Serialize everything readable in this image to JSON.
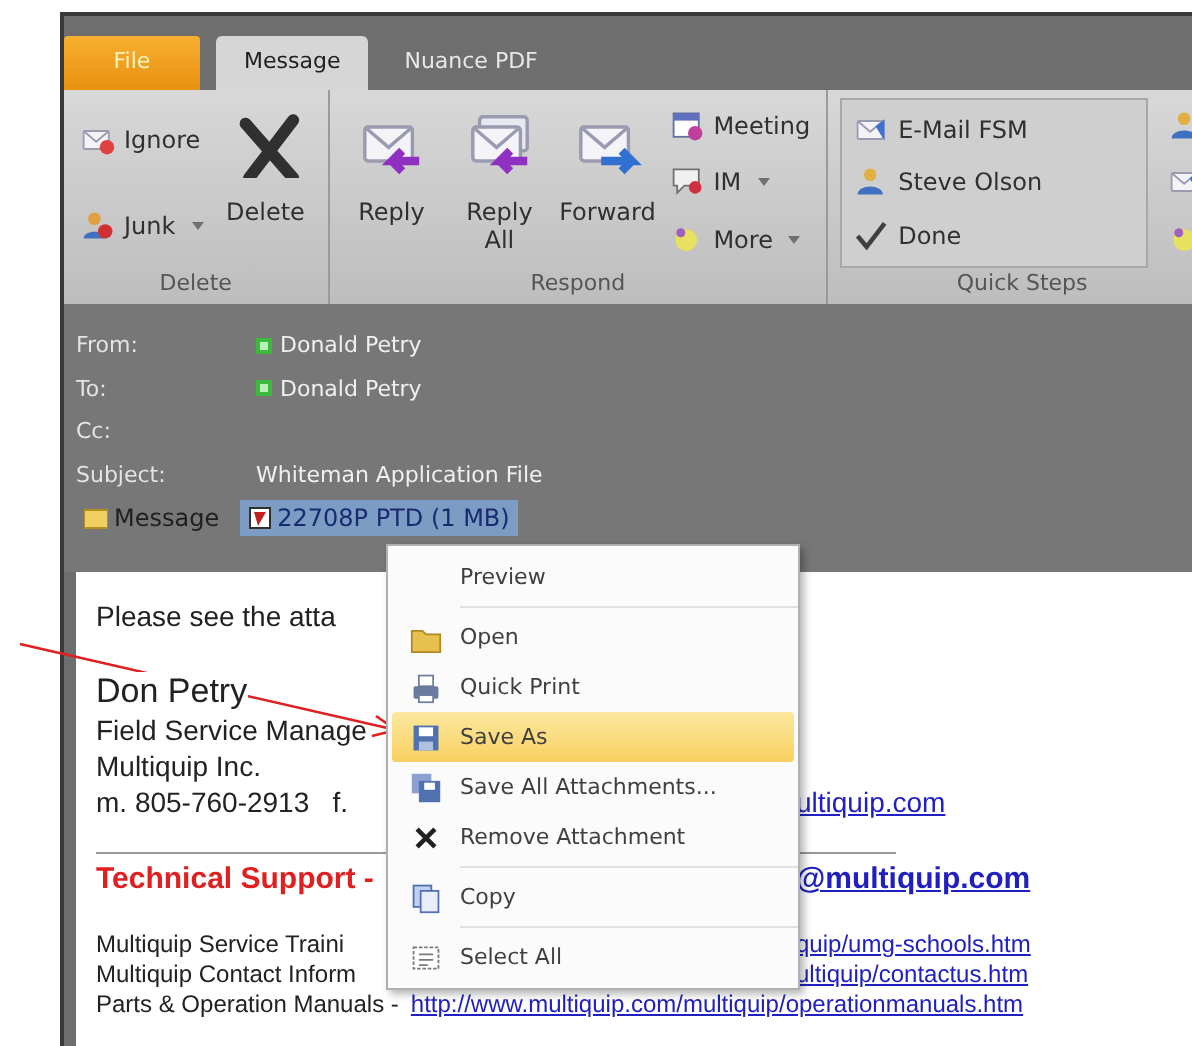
{
  "tabs": [
    {
      "label": "File",
      "kind": "file",
      "selected": false
    },
    {
      "label": "Message",
      "kind": "tab",
      "selected": true
    },
    {
      "label": "Nuance PDF",
      "kind": "tab",
      "selected": false
    }
  ],
  "ribbon": {
    "groups": [
      {
        "label": "Delete",
        "kind": "delete",
        "small": [
          {
            "label": "Ignore",
            "dropdown": false
          },
          {
            "label": "Junk",
            "dropdown": true
          }
        ],
        "large": [
          {
            "label": "Delete"
          }
        ]
      },
      {
        "label": "Respond",
        "kind": "respond",
        "large": [
          {
            "label": "Reply"
          },
          {
            "label": "Reply All"
          },
          {
            "label": "Forward"
          }
        ],
        "small_after": [
          {
            "label": "Meeting",
            "dropdown": false
          },
          {
            "label": "IM",
            "dropdown": true
          },
          {
            "label": "More",
            "dropdown": true
          }
        ]
      },
      {
        "label": "Quick Steps",
        "kind": "quick",
        "small": [
          {
            "label": "E-Mail FSM",
            "dropdown": false
          },
          {
            "label": "Steve Olson",
            "dropdown": false
          },
          {
            "label": "Done",
            "dropdown": false
          }
        ]
      }
    ]
  },
  "header": [
    {
      "label": "From:",
      "value": "Donald Petry",
      "presence": true
    },
    {
      "label": "To:",
      "value": "Donald Petry",
      "presence": true
    },
    {
      "label": "Cc:",
      "presence": false
    },
    {
      "label": "Subject:",
      "value": "Whiteman Application File",
      "presence": false
    }
  ],
  "attachments": [
    {
      "label": "Message",
      "kind": "message",
      "selected": false
    },
    {
      "label": "22708P PTD (1 MB)",
      "kind": "file",
      "selected": true
    }
  ],
  "body": {
    "greeting": "Please see the atta",
    "name": "Don Petry",
    "lines": [
      "Field Service Manage",
      "Multiquip Inc."
    ],
    "phone": {
      "text": "m. 805-760-2913   f.",
      "link": "ultiquip.com"
    },
    "support": {
      "text": "Technical Support -",
      "link": "@multiquip.com"
    },
    "links": [
      {
        "text": "Multiquip Service Traini",
        "link": "quip/umg-schools.htm",
        "kind": "behind"
      },
      {
        "text": "Multiquip Contact Inform",
        "link": "ultiquip/contactus.htm",
        "kind": "behind"
      },
      {
        "text": "Parts & Operation Manuals -",
        "link": "http://www.multiquip.com/multiquip/operationmanuals.htm",
        "kind": "inline"
      }
    ]
  },
  "context_menu": {
    "items": [
      {
        "label": "Preview",
        "kind": "preview",
        "selected": false,
        "divider_after": true
      },
      {
        "label": "Open",
        "kind": "open",
        "selected": false,
        "divider_after": false
      },
      {
        "label": "Quick Print",
        "kind": "print",
        "selected": false,
        "divider_after": false
      },
      {
        "label": "Save As",
        "kind": "save",
        "selected": true,
        "divider_after": false
      },
      {
        "label": "Save All Attachments...",
        "kind": "save-all",
        "selected": false,
        "divider_after": false
      },
      {
        "label": "Remove Attachment",
        "kind": "remove",
        "selected": false,
        "divider_after": true
      },
      {
        "label": "Copy",
        "kind": "copy",
        "selected": false,
        "divider_after": true
      },
      {
        "label": "Select All",
        "kind": "select-all",
        "selected": false,
        "divider_after": false
      }
    ]
  }
}
